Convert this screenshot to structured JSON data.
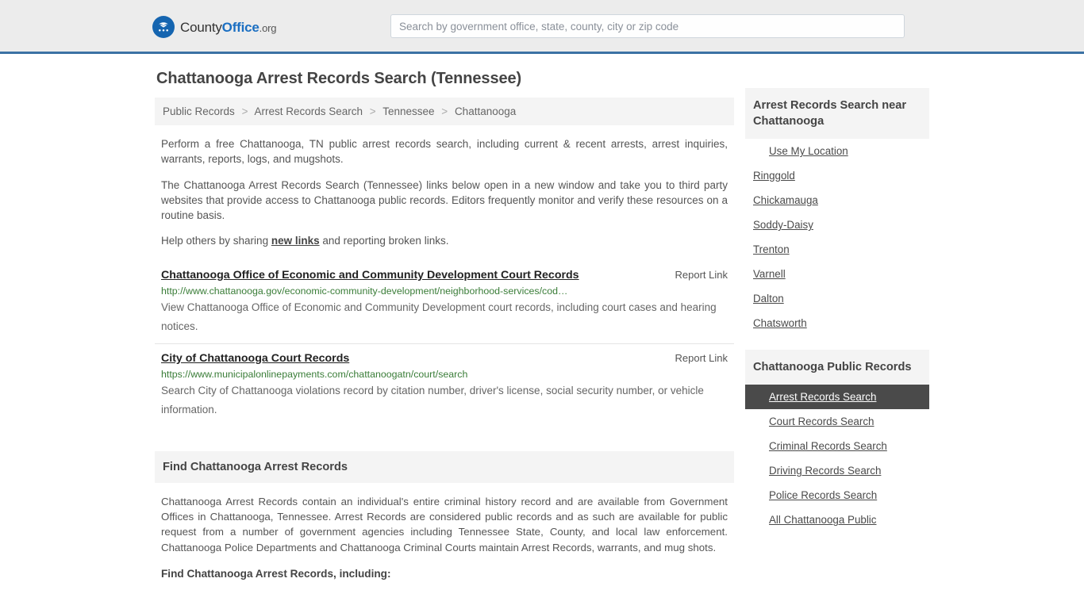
{
  "header": {
    "brand": {
      "part1": "County",
      "part2": "Office",
      "part3": ".org",
      "icon": "eagle-seal-icon"
    },
    "search": {
      "value": "",
      "placeholder": "Search by government office, state, county, city or zip code"
    }
  },
  "page": {
    "title": "Chattanooga Arrest Records Search (Tennessee)"
  },
  "breadcrumb": {
    "items": [
      {
        "label": "Public Records"
      },
      {
        "label": "Arrest Records Search"
      },
      {
        "label": "Tennessee"
      },
      {
        "label": "Chattanooga"
      }
    ],
    "separator": ">"
  },
  "intro": {
    "p1": "Perform a free Chattanooga, TN public arrest records search, including current & recent arrests, arrest inquiries, warrants, reports, logs, and mugshots.",
    "p2": "The Chattanooga Arrest Records Search (Tennessee) links below open in a new window and take you to third party websites that provide access to Chattanooga public records. Editors frequently monitor and verify these resources on a routine basis.",
    "p3_before": "Help others by sharing ",
    "p3_link": "new links",
    "p3_after": " and reporting broken links."
  },
  "results": [
    {
      "title": "Chattanooga Office of Economic and Community Development Court Records",
      "report_label": "Report Link",
      "url": "http://www.chattanooga.gov/economic-community-development/neighborhood-services/cod…",
      "description": "View Chattanooga Office of Economic and Community Development court records, including court cases and hearing notices."
    },
    {
      "title": "City of Chattanooga Court Records",
      "report_label": "Report Link",
      "url": "https://www.municipalonlinepayments.com/chattanoogatn/court/search",
      "description": "Search City of Chattanooga violations record by citation number, driver's license, social security number, or vehicle information."
    }
  ],
  "section": {
    "heading": "Find Chattanooga Arrest Records",
    "body": "Chattanooga Arrest Records contain an individual's entire criminal history record and are available from Government Offices in Chattanooga, Tennessee. Arrest Records are considered public records and as such are available for public request from a number of government agencies including Tennessee State, County, and local law enforcement. Chattanooga Police Departments and Chattanooga Criminal Courts maintain Arrest Records, warrants, and mug shots.",
    "subheading": "Find Chattanooga Arrest Records, including:"
  },
  "sidebar": {
    "nearby": {
      "heading": "Arrest Records Search near Chattanooga",
      "items": [
        {
          "label": "Use My Location",
          "indented": true
        },
        {
          "label": "Ringgold",
          "indented": false
        },
        {
          "label": "Chickamauga",
          "indented": false
        },
        {
          "label": "Soddy-Daisy",
          "indented": false
        },
        {
          "label": "Trenton",
          "indented": false
        },
        {
          "label": "Varnell",
          "indented": false
        },
        {
          "label": "Dalton",
          "indented": false
        },
        {
          "label": "Chatsworth",
          "indented": false
        }
      ]
    },
    "public_records": {
      "heading": "Chattanooga Public Records",
      "items": [
        {
          "label": "Arrest Records Search",
          "active": true
        },
        {
          "label": "Court Records Search",
          "active": false
        },
        {
          "label": "Criminal Records Search",
          "active": false
        },
        {
          "label": "Driving Records Search",
          "active": false
        },
        {
          "label": "Police Records Search",
          "active": false
        },
        {
          "label": "All Chattanooga Public",
          "active": false
        }
      ]
    }
  },
  "colors": {
    "header_bg": "#ececec",
    "header_border": "#3b72a4",
    "brand_blue": "#1b6fc2",
    "url_green": "#3a7d38",
    "active_bg": "#4a4a4a",
    "panel_bg": "#f4f4f4"
  }
}
